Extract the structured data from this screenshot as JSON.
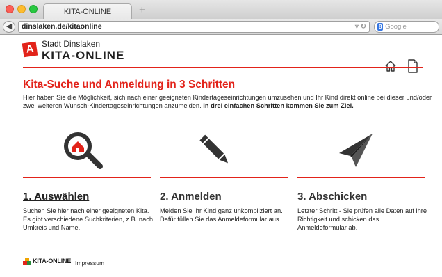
{
  "browser": {
    "tab_title": "KITA-ONLINE",
    "new_tab": "+",
    "url": "dinslaken.de/kitaonline",
    "search_placeholder": "Google",
    "search_badge": "8"
  },
  "header": {
    "logo_letter": "A",
    "brand_top": "Stadt Dinslaken",
    "brand_main": "KITA-ONLINE",
    "icons": [
      "home-icon",
      "document-icon"
    ]
  },
  "main": {
    "heading": "Kita-Suche und Anmeldung in 3 Schritten",
    "intro_text": "Hier haben Sie die Möglichkeit, sich nach einer geeigneten Kindertageseinrichtungen umzusehen und Ihr Kind direkt online bei dieser und/oder zwei weiteren Wunsch-Kindertageseinrichtungen anzumelden.",
    "intro_bold": "In drei einfachen Schritten kommen Sie zum Ziel.",
    "steps": [
      {
        "icon": "search-house-icon",
        "title": "1. Auswählen",
        "text": "Suchen Sie hier nach einer geeigneten Kita. Es gibt verschiedene Suchkriterien, z.B. nach Umkreis und Name."
      },
      {
        "icon": "pencil-icon",
        "title": "2. Anmelden",
        "text": "Melden Sie Ihr Kind ganz unkompliziert an. Dafür füllen Sie das Anmeldeformular aus."
      },
      {
        "icon": "paper-plane-icon",
        "title": "3. Abschicken",
        "text": "Letzter Schritt - Sie prüfen alle Daten auf ihre Richtigkeit und schicken das Anmeldeformular ab."
      }
    ]
  },
  "footer": {
    "brand": "KITA-ONLINE",
    "link": "Impressum"
  },
  "colors": {
    "accent": "#e2231a",
    "text": "#222222",
    "icon_dark": "#333333"
  }
}
